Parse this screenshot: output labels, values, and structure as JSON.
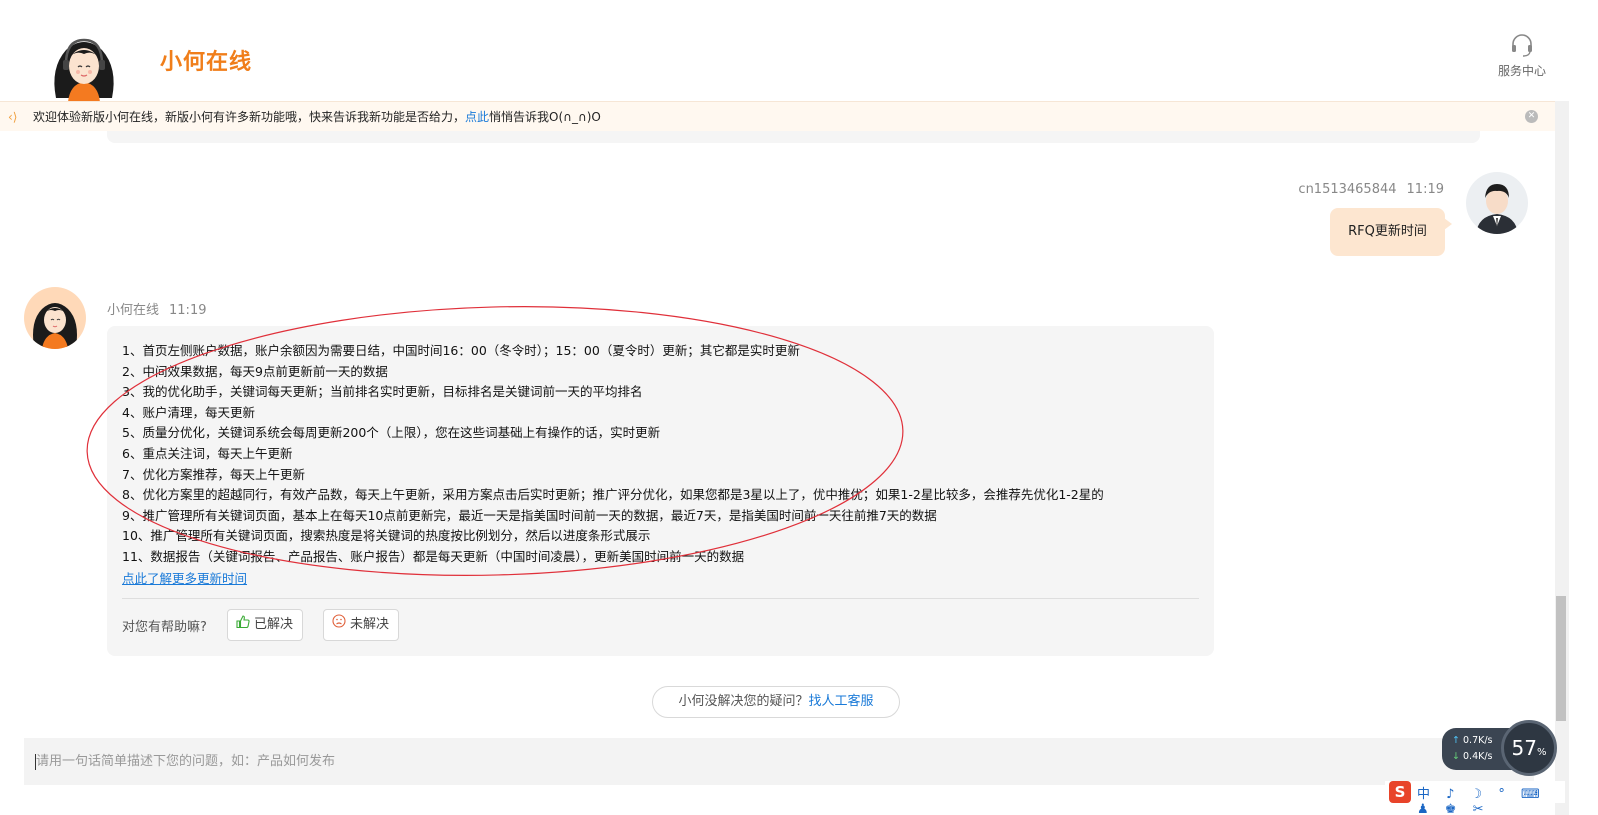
{
  "header": {
    "brand": "小何在线",
    "service_center": "服务中心"
  },
  "notice": {
    "text_before": "欢迎体验新版小何在线，新版小何有许多新功能哦，快来告诉我新功能是否给力，",
    "link": "点此",
    "text_after": "悄悄告诉我O(∩_∩)O"
  },
  "user_message": {
    "username": "cn1513465844",
    "time": "11:19",
    "text": "RFQ更新时间"
  },
  "bot_message": {
    "name": "小何在线",
    "time": "11:19",
    "lines": [
      "1、首页左侧账户数据，账户余额因为需要日结，中国时间16：00（冬令时）；15：00（夏令时）更新；其它都是实时更新",
      "2、中间效果数据，每天9点前更新前一天的数据",
      "3、我的优化助手，关键词每天更新；当前排名实时更新，目标排名是关键词前一天的平均排名",
      "4、账户清理，每天更新",
      "5、质量分优化，关键词系统会每周更新200个（上限），您在这些词基础上有操作的话，实时更新",
      "6、重点关注词，每天上午更新",
      "7、优化方案推荐，每天上午更新",
      "8、优化方案里的超越同行，有效产品数，每天上午更新，采用方案点击后实时更新；推广评分优化，如果您都是3星以上了，优中推优；如果1-2星比较多，会推荐先优化1-2星的",
      "9、推广管理所有关键词页面，基本上在每天10点前更新完，最近一天是指美国时间前一天的数据，最近7天，是指美国时间前一天往前推7天的数据",
      "10、推广管理所有关键词页面，搜索热度是将关键词的热度按比例划分，然后以进度条形式展示",
      "11、数据报告（关键词报告、产品报告、账户报告）都是每天更新（中国时间凌晨），更新美国时间前一天的数据"
    ],
    "more_link": "点此了解更多更新时间",
    "helpful_question": "对您有帮助嘛?",
    "resolved": "已解决",
    "unresolved": "未解决"
  },
  "human_service": {
    "text": "小何没解决您的疑问？",
    "link": "找人工客服"
  },
  "input": {
    "placeholder": "请用一句话简单描述下您的问题，如：产品如何发布"
  },
  "net_widget": {
    "upload": "0.7",
    "download": "0.4",
    "unit": "K/s",
    "percent": "57",
    "percent_sign": "%"
  },
  "ime": {
    "logo": "S",
    "items": "中 ♪ ☽ ° ⌨ ♟ ♚ ✂"
  },
  "colors": {
    "brand": "#f07e1a",
    "link": "#1a7ad8",
    "user_bubble": "#fde6d0",
    "bot_bubble": "#f5f5f5",
    "annotation_oval": "#e0303a"
  }
}
